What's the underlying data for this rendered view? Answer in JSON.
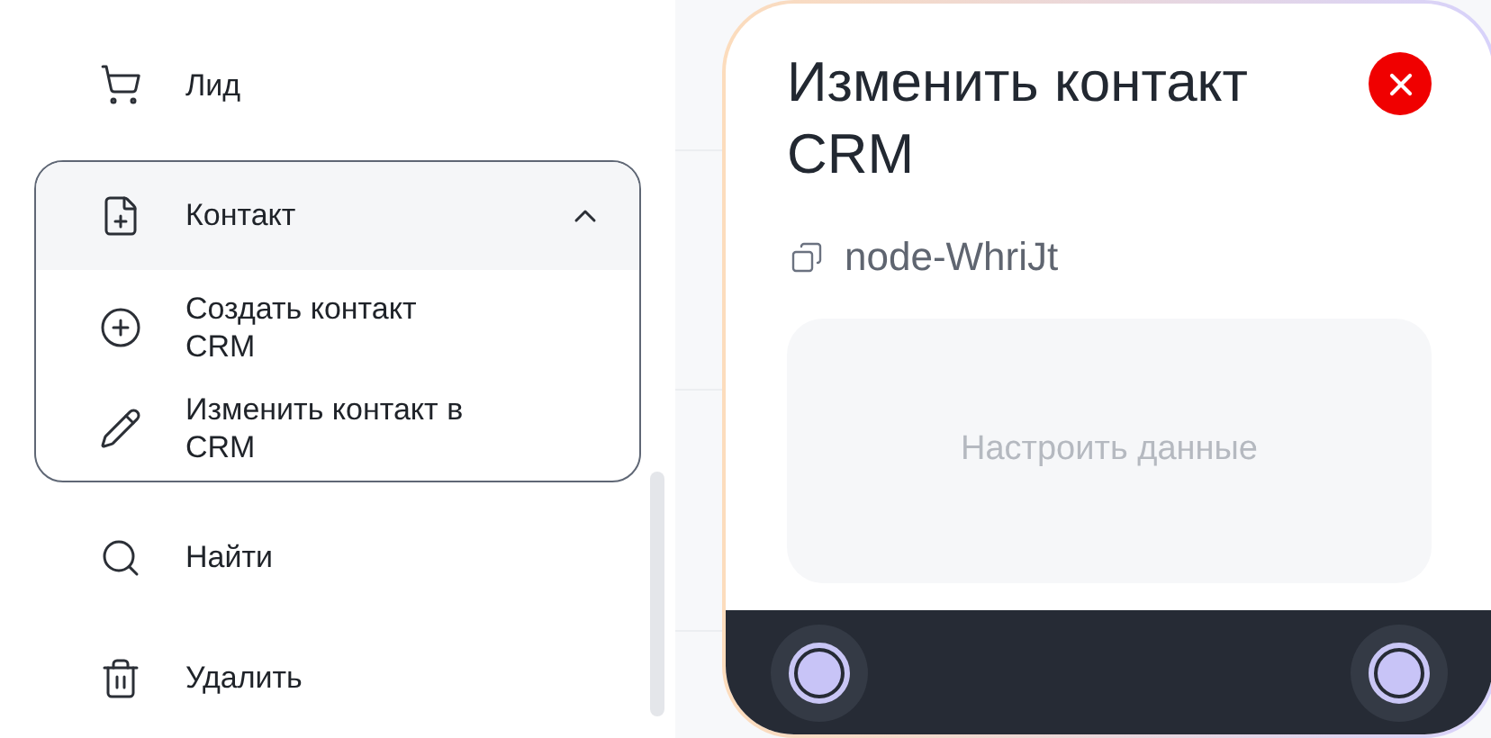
{
  "menu": {
    "items": [
      {
        "kind": "item",
        "label": "Лид"
      },
      {
        "kind": "group",
        "label": "Контакт",
        "expanded": true,
        "children": [
          {
            "label": "Создать контакт CRM"
          },
          {
            "label": "Изменить контакт в CRM"
          }
        ]
      },
      {
        "kind": "item",
        "label": "Найти"
      },
      {
        "kind": "item",
        "label": "Удалить"
      }
    ]
  },
  "node": {
    "title": "Изменить контакт CRM",
    "id": "node-WhriJt",
    "action": "Настроить данные"
  }
}
